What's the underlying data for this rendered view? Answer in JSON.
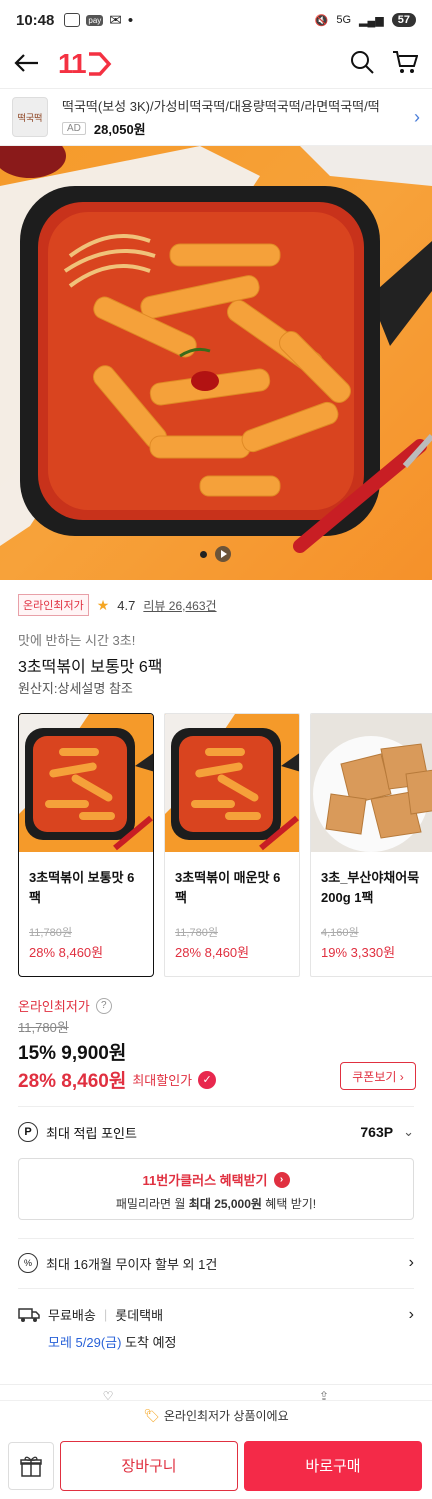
{
  "status_bar": {
    "time": "10:48",
    "pay": "pay",
    "signal": "5G",
    "battery": "57"
  },
  "header": {
    "logo": "11"
  },
  "ad": {
    "thumb_label": "떡국떡",
    "title": "떡국떡(보성 3K)/가성비떡국떡/대용량떡국떡/라면떡국떡/떡",
    "tag": "AD",
    "price": "28,050원"
  },
  "product": {
    "badge": "온라인최저가",
    "rating": "4.7",
    "review_label": "리뷰 26,463건",
    "subtitle": "맛에 반하는 시간 3초!",
    "title": "3초떡볶이 보통맛 6팩",
    "origin": "원산지:상세설명 참조"
  },
  "options": [
    {
      "name": "3초떡볶이 보통맛 6팩",
      "orig": "11,780원",
      "price": "28% 8,460원",
      "selected": true
    },
    {
      "name": "3초떡볶이 매운맛 6팩",
      "orig": "11,780원",
      "price": "28% 8,460원",
      "selected": false
    },
    {
      "name": "3초_부산야채어묵 200g 1팩",
      "orig": "4,160원",
      "price": "19% 3,330원",
      "selected": false
    }
  ],
  "pricing": {
    "lowest_label": "온라인최저가",
    "original": "11,780원",
    "discount1": "15% 9,900원",
    "discount2": "28% 8,460원",
    "max_label": "최대할인가",
    "coupon": "쿠폰보기 ›"
  },
  "points": {
    "label": "최대 적립 포인트",
    "value": "763P"
  },
  "club": {
    "title": "11번가클러스 혜택받기",
    "sub_pre": "패밀리라면 월 ",
    "sub_bold": "최대 25,000원",
    "sub_post": " 혜택 받기!"
  },
  "installment": {
    "label": "최대 16개월 무이자 할부 외 1건"
  },
  "shipping": {
    "free": "무료배송",
    "carrier": "롯데택배",
    "date": "모레 5/29(금)",
    "arrival": " 도착 예정"
  },
  "notice": {
    "text": "온라인최저가 상품이에요"
  },
  "buttons": {
    "cart": "장바구니",
    "buy": "바로구매"
  },
  "colors": {
    "brand": "#f43142",
    "accent_red": "#e03040",
    "orange_bg": "#f59a2a"
  }
}
